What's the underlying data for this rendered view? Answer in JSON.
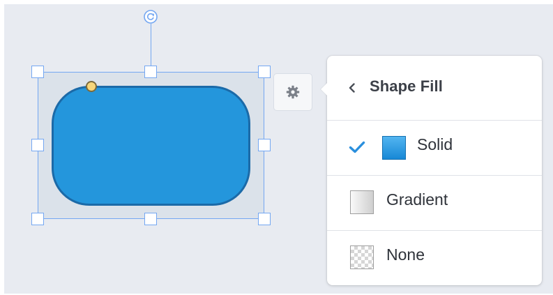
{
  "panel": {
    "title": "Shape Fill",
    "back_icon": "chevron-left-icon",
    "options": [
      {
        "label": "Solid",
        "selected": true,
        "icon": "solid-fill-swatch-icon"
      },
      {
        "label": "Gradient",
        "selected": false,
        "icon": "gradient-fill-swatch-icon"
      },
      {
        "label": "None",
        "selected": false,
        "icon": "no-fill-swatch-icon"
      }
    ]
  },
  "shape": {
    "type": "rounded-rectangle",
    "fill_color": "#2496dc",
    "stroke_color": "#1b6aa8"
  },
  "selection": {
    "outline_color": "#74a7f2",
    "rotate_icon": "rotate-icon",
    "corner_radius_handle_icon": "corner-radius-handle"
  },
  "settings_button": {
    "icon": "gear-icon"
  },
  "colors": {
    "canvas": "#e8ebf1",
    "checkmark": "#2a8fdd",
    "text": "#2f333a"
  }
}
